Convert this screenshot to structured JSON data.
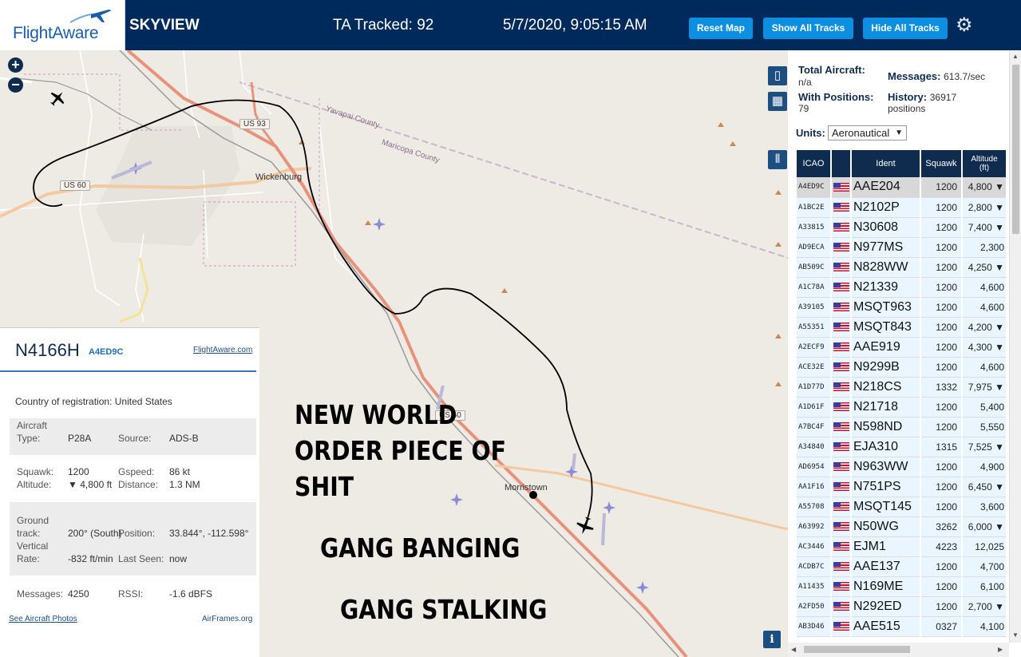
{
  "header": {
    "logo": "FlightAware",
    "app_name": "SKYVIEW",
    "tracked_label": "TA Tracked: 92",
    "clock": "5/7/2020, 9:05:15 AM",
    "buttons": {
      "reset": "Reset Map",
      "show_all": "Show All Tracks",
      "hide_all": "Hide All Tracks"
    },
    "settings_icon": "gear-icon"
  },
  "map": {
    "zoom_in": "+",
    "zoom_out": "−",
    "info": "i",
    "places": {
      "wickenburg": "Wickenburg",
      "morristown": "Morristown"
    },
    "counties": {
      "yavapai": "Yavapai County",
      "maricopa": "Maricopa County"
    },
    "shields": {
      "us93": "US 93",
      "us60": "US 60",
      "us60b": "US 60"
    },
    "overlay_text": {
      "line1": "NEW WORLD",
      "line2": "ORDER PIECE OF",
      "line3": "SHIT",
      "line4": "GANG BANGING",
      "line5": "GANG STALKING"
    }
  },
  "detail": {
    "ident": "N4166H",
    "hex": "A4ED9C",
    "link": "FlightAware.com",
    "country_label": "Country of registration:",
    "country_value": "United States",
    "aircraft_type_label_1": "Aircraft",
    "aircraft_type_label_2": "Type:",
    "aircraft_type": "P28A",
    "source_label": "Source:",
    "source": "ADS-B",
    "squawk_label": "Squawk:",
    "squawk": "1200",
    "gspeed_label": "Gspeed:",
    "gspeed": "86 kt",
    "altitude_label": "Altitude:",
    "altitude": "▼ 4,800 ft",
    "distance_label": "Distance:",
    "distance": "1.3 NM",
    "ground_label_1": "Ground",
    "ground_label_2": "track:",
    "ground_track": "200° (South)",
    "position_label": "Position:",
    "position": "33.844°, -112.598°",
    "vrate_label_1": "Vertical",
    "vrate_label_2": "Rate:",
    "vertical_rate": "-832 ft/min",
    "last_seen_label": "Last Seen:",
    "last_seen": "now",
    "messages_label": "Messages:",
    "messages": "4250",
    "rssi_label": "RSSI:",
    "rssi": "-1.6 dBFS",
    "photos_link": "See Aircraft Photos",
    "airframes_link": "AirFrames.org"
  },
  "stats": {
    "total_label": "Total Aircraft:",
    "total_value": "n/a",
    "messages_label": "Messages:",
    "messages_value": "613.7/sec",
    "positions_label": "With Positions:",
    "positions_value": "79",
    "history_label": "History:",
    "history_value_1": "36917",
    "history_value_2": "positions",
    "units_label": "Units:",
    "units_value": "Aeronautical"
  },
  "table": {
    "headers": {
      "icao": "ICAO",
      "ident": "Ident",
      "squawk": "Squawk",
      "alt_1": "Altitude",
      "alt_2": "(ft)"
    },
    "rows": [
      {
        "icao": "A4ED9C",
        "ident": "AAE204",
        "squawk": "1200",
        "alt": "4,800 ▼"
      },
      {
        "icao": "A1BC2E",
        "ident": "N2102P",
        "squawk": "1200",
        "alt": "2,800 ▼"
      },
      {
        "icao": "A33815",
        "ident": "N30608",
        "squawk": "1200",
        "alt": "7,400 ▼"
      },
      {
        "icao": "AD9ECA",
        "ident": "N977MS",
        "squawk": "1200",
        "alt": "2,300"
      },
      {
        "icao": "AB509C",
        "ident": "N828WW",
        "squawk": "1200",
        "alt": "4,250 ▼"
      },
      {
        "icao": "A1C78A",
        "ident": "N21339",
        "squawk": "1200",
        "alt": "4,600"
      },
      {
        "icao": "A39105",
        "ident": "MSQT963",
        "squawk": "1200",
        "alt": "4,600"
      },
      {
        "icao": "A55351",
        "ident": "MSQT843",
        "squawk": "1200",
        "alt": "4,200 ▼"
      },
      {
        "icao": "A2ECF9",
        "ident": "AAE919",
        "squawk": "1200",
        "alt": "4,300 ▼"
      },
      {
        "icao": "ACE32E",
        "ident": "N9299B",
        "squawk": "1200",
        "alt": "4,600"
      },
      {
        "icao": "A1D77D",
        "ident": "N218CS",
        "squawk": "1332",
        "alt": "7,975 ▼"
      },
      {
        "icao": "A1D61F",
        "ident": "N21718",
        "squawk": "1200",
        "alt": "5,400"
      },
      {
        "icao": "A7BC4F",
        "ident": "N598ND",
        "squawk": "1200",
        "alt": "5,550"
      },
      {
        "icao": "A34840",
        "ident": "EJA310",
        "squawk": "1315",
        "alt": "7,525 ▼"
      },
      {
        "icao": "AD6954",
        "ident": "N963WW",
        "squawk": "1200",
        "alt": "4,900"
      },
      {
        "icao": "AA1F16",
        "ident": "N751PS",
        "squawk": "1200",
        "alt": "6,450 ▼"
      },
      {
        "icao": "A55708",
        "ident": "MSQT145",
        "squawk": "1200",
        "alt": "3,600"
      },
      {
        "icao": "A63992",
        "ident": "N50WG",
        "squawk": "3262",
        "alt": "6,000 ▼"
      },
      {
        "icao": "AC3446",
        "ident": "EJM1",
        "squawk": "4223",
        "alt": "12,025"
      },
      {
        "icao": "ACDB7C",
        "ident": "AAE137",
        "squawk": "1200",
        "alt": "4,700"
      },
      {
        "icao": "A11435",
        "ident": "N169ME",
        "squawk": "1200",
        "alt": "6,100"
      },
      {
        "icao": "A2FD50",
        "ident": "N292ED",
        "squawk": "1200",
        "alt": "2,700 ▼"
      },
      {
        "icao": "AB3D46",
        "ident": "AAE515",
        "squawk": "0327",
        "alt": "4,100"
      }
    ]
  },
  "colors": {
    "header_bg": "#002a5c",
    "button": "#0c8fe0",
    "row_bg": "#e9f6ff",
    "selected_row": "#d8d8d8",
    "road_major": "#e8927c",
    "track": "#000000"
  }
}
